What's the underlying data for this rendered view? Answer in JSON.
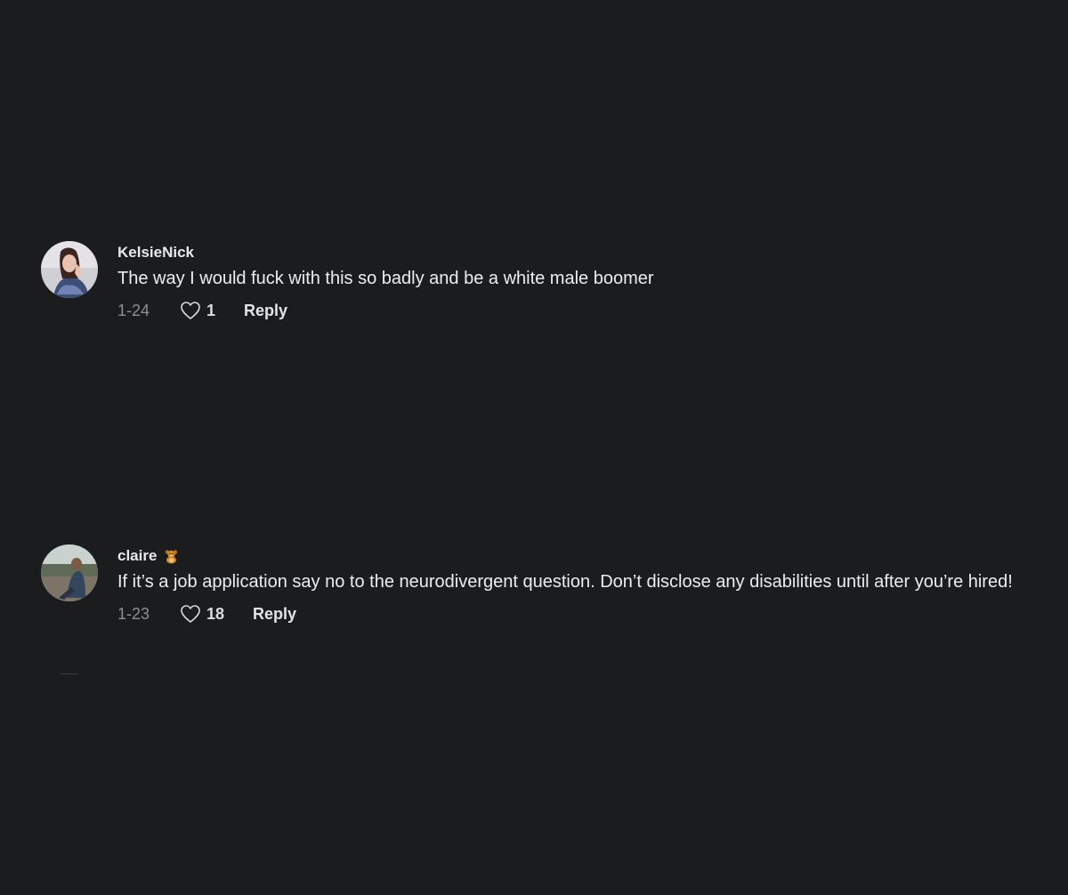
{
  "comments": [
    {
      "username": "KelsieNick",
      "text": "The way I would fuck with this so badly and be a white male boomer",
      "date": "1-24",
      "likes": "1",
      "reply_label": "Reply",
      "avatar_icon": "user-avatar-photo"
    },
    {
      "username": "claire",
      "badge_icon": "teddy-bear-emoji-icon",
      "text": "If it’s a job application say no to the neurodivergent question. Don’t disclose any disabilities until after you’re hired!",
      "date": "1-23",
      "likes": "18",
      "reply_label": "Reply",
      "avatar_icon": "user-avatar-photo"
    }
  ],
  "colors": {
    "background": "#1b1c1e",
    "text_primary": "#ededed",
    "text_secondary": "#8d8e90"
  }
}
